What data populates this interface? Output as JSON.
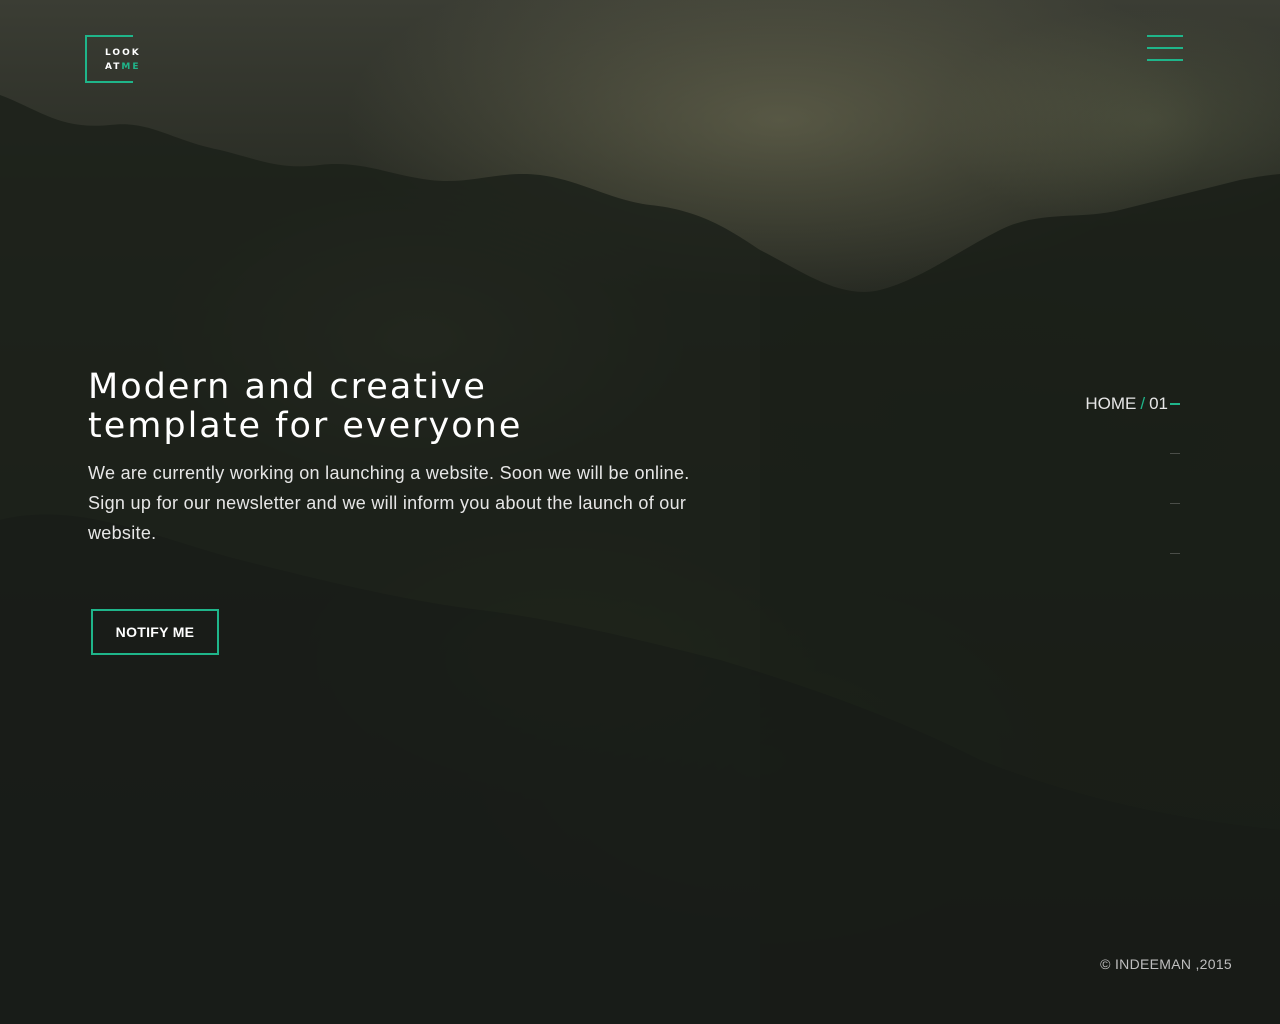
{
  "logo": {
    "line1": "LOOK",
    "line2_prefix": "AT",
    "line2_accent": "ME"
  },
  "menu": {
    "icon": "hamburger-menu-icon"
  },
  "hero": {
    "title_line1": "Modern and creative",
    "title_line2": "template for everyone",
    "description": "We are currently working on launching a website. Soon we will be online. Sign up for our newsletter and we will inform you about the launch of our website.",
    "cta_label": "NOTIFY ME"
  },
  "section_nav": {
    "current_label": "HOME",
    "separator": "/",
    "current_number": "01",
    "total_sections": 4,
    "active_index": 0
  },
  "footer": {
    "copyright": "© INDEEMAN ,2015"
  },
  "colors": {
    "accent": "#1fb58a",
    "text": "#ffffff",
    "background": "#17171b"
  }
}
